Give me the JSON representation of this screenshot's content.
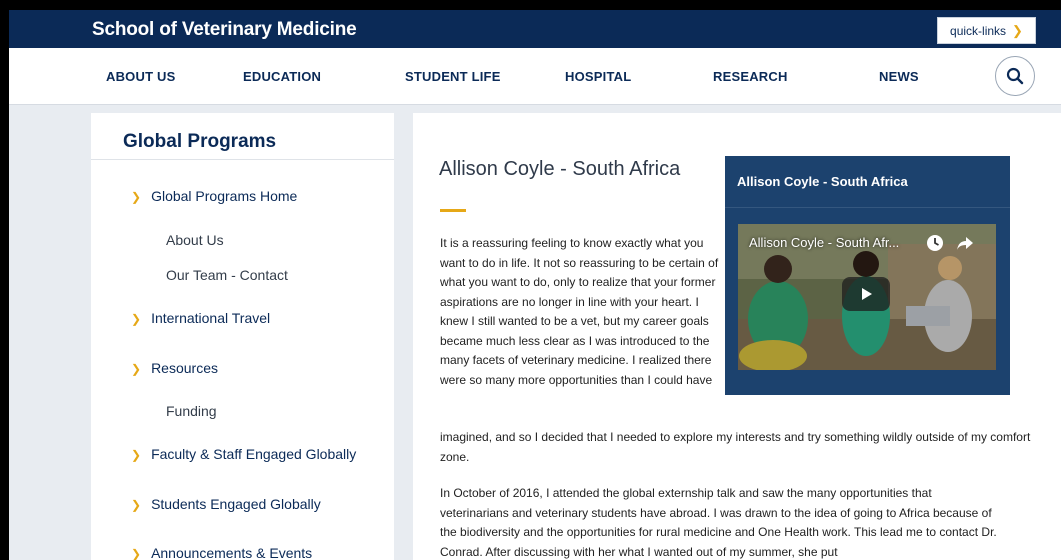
{
  "header": {
    "site_title": "School of Veterinary Medicine",
    "quick_links_label": "quick-links",
    "quick_links_icon": "chevron-right-icon"
  },
  "nav": {
    "items": [
      "ABOUT US",
      "EDUCATION",
      "STUDENT LIFE",
      "HOSPITAL",
      "RESEARCH",
      "NEWS"
    ],
    "search_icon": "search-icon"
  },
  "sidebar": {
    "title": "Global Programs",
    "items": [
      {
        "label": "Global Programs Home",
        "level": 1
      },
      {
        "label": "About Us",
        "level": 2
      },
      {
        "label": "Our Team - Contact",
        "level": 2
      },
      {
        "label": "International Travel",
        "level": 1
      },
      {
        "label": "Resources",
        "level": 1
      },
      {
        "label": "Funding",
        "level": 2
      },
      {
        "label": "Faculty & Staff Engaged Globally",
        "level": 1
      },
      {
        "label": "Students Engaged Globally",
        "level": 1
      },
      {
        "label": "Announcements & Events",
        "level": 1
      }
    ]
  },
  "article": {
    "title": "Allison Coyle - South Africa",
    "paragraph1_a": "It is a reassuring feeling to know exactly what you want to do in life. It not so reassuring to be certain of what you want to do, only to realize that your former aspirations are no longer in line with your heart. I knew I still wanted to be a vet, but my career goals became much less clear as I was introduced to the many facets of veterinary medicine. I realized there were so many more opportunities than I could have",
    "paragraph1_b": "imagined, and so I decided that I needed to explore my interests and try something wildly outside of my comfort zone.",
    "paragraph2": "In October of 2016, I attended the global externship talk and saw the many opportunities that veterinarians and veterinary students have abroad. I was drawn to the idea of going to Africa because of the biodiversity and the opportunities for rural medicine and One Health work. This lead me to contact Dr. Conrad. After discussing with her what I wanted out of my summer, she put"
  },
  "video": {
    "heading": "Allison Coyle - South Africa",
    "title": "Allison Coyle - South Afr...",
    "icons": [
      "clock-icon",
      "share-icon",
      "play-icon"
    ]
  },
  "colors": {
    "brand_navy": "#0b2a57",
    "accent_gold": "#e6a817",
    "video_box": "#1c426e",
    "page_bg": "#e8ecf1"
  }
}
